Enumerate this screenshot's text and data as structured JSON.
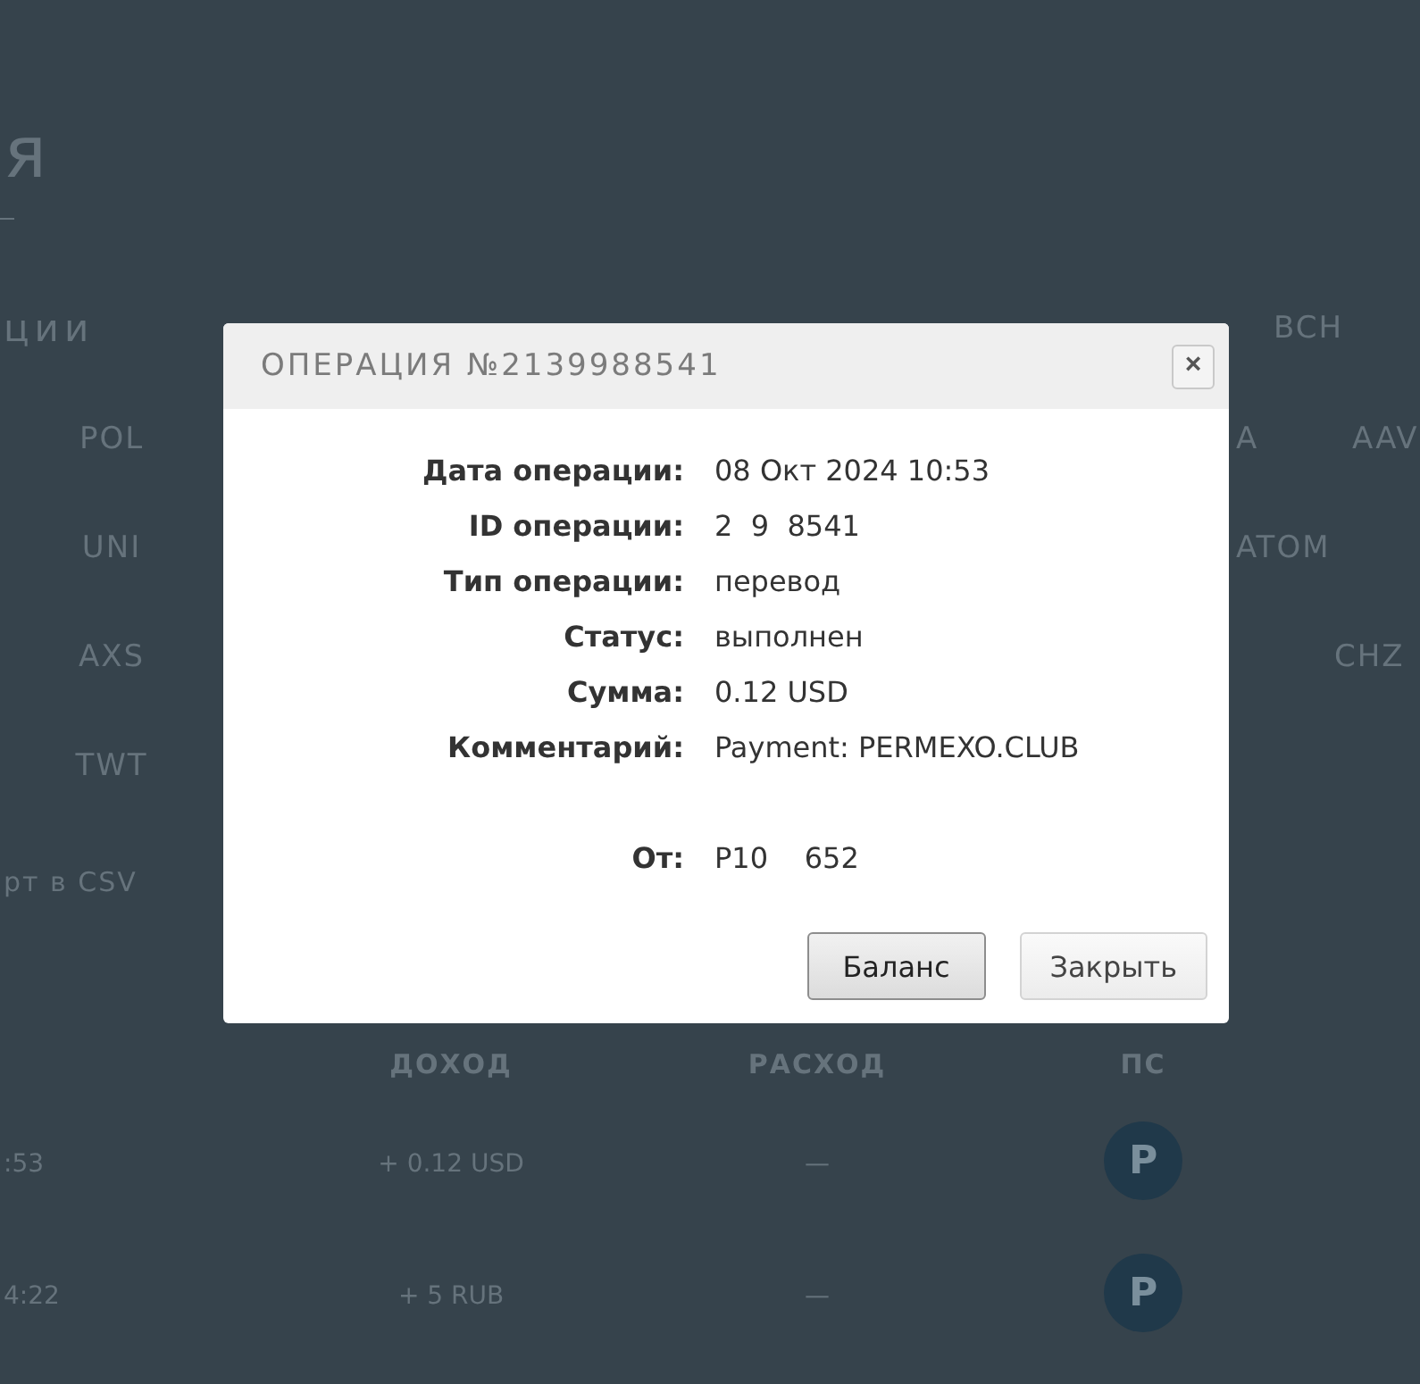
{
  "page": {
    "title": "я",
    "tab_label": "ции",
    "header_coin": "BCH",
    "coin_rows": [
      {
        "left": "POL",
        "right": [
          "A",
          "AAV"
        ]
      },
      {
        "left": "UNI",
        "right": [
          "ATOM"
        ]
      },
      {
        "left": "AXS",
        "right": [
          "CHZ"
        ]
      },
      {
        "left": "TWT",
        "right": []
      }
    ],
    "export_link": "рт в CSV",
    "table": {
      "columns": [
        "ДОХОД",
        "РАСХОД",
        "ПС"
      ],
      "rows": [
        {
          "time": ":53",
          "income": "+ 0.12 USD",
          "expense": "—",
          "system": "P"
        },
        {
          "time": "4:22",
          "income": "+ 5 RUB",
          "expense": "—",
          "system": "P"
        }
      ]
    }
  },
  "dialog": {
    "title": "ОПЕРАЦИЯ №2139988541",
    "close": "×",
    "fields": [
      {
        "label": "Дата операции:",
        "value": "08 Окт 2024 10:53"
      },
      {
        "label": "ID операции:",
        "value": "2  9  8541"
      },
      {
        "label": "Тип операции:",
        "value": "перевод"
      },
      {
        "label": "Статус:",
        "value": "выполнен"
      },
      {
        "label": "Сумма:",
        "value": "0.12 USD"
      },
      {
        "label": "Комментарий:",
        "value": "Payment: PERMEXO.CLUB"
      }
    ],
    "sender_fields": [
      {
        "label": "От:",
        "value": "P10    652"
      }
    ],
    "buttons": [
      {
        "label": "Баланс",
        "primary": true
      },
      {
        "label": "Закрыть",
        "primary": false
      }
    ]
  }
}
